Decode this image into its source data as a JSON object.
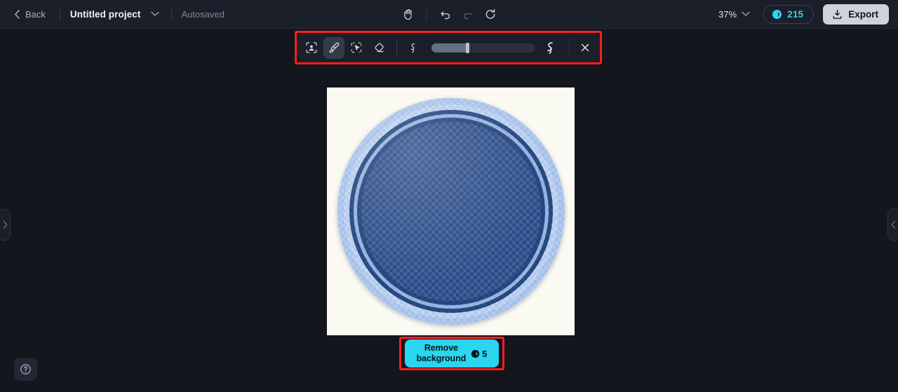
{
  "header": {
    "back_label": "Back",
    "project_title": "Untitled project",
    "project_menu_icon": "chevron-down-icon",
    "autosaved_label": "Autosaved",
    "tools": [
      {
        "name": "hand-tool",
        "icon": "hand-icon"
      },
      {
        "name": "undo-button",
        "icon": "undo-icon"
      },
      {
        "name": "redo-button",
        "icon": "redo-icon"
      },
      {
        "name": "reset-button",
        "icon": "refresh-icon"
      }
    ],
    "zoom_level": "37%",
    "zoom_menu_icon": "chevron-down-icon",
    "credits": {
      "icon": "coin-icon",
      "amount": "215"
    },
    "export_label": "Export",
    "export_icon": "download-icon"
  },
  "edit_toolbar": {
    "tools": [
      {
        "name": "select-subject-tool",
        "icon": "person-select-icon",
        "active": false
      },
      {
        "name": "brush-tool",
        "icon": "brush-icon",
        "active": true
      },
      {
        "name": "magic-select-tool",
        "icon": "magic-cursor-icon",
        "active": false
      },
      {
        "name": "eraser-tool",
        "icon": "eraser-icon",
        "active": false
      }
    ],
    "brush_size": {
      "min_icon": "small-brush-icon",
      "max_icon": "large-brush-icon",
      "value_percent": 33
    },
    "close_label": "",
    "close_icon": "close-icon",
    "highlight_color": "#fb1f1f"
  },
  "canvas": {
    "artboard_background": "#fbfaf2",
    "selection_mask_color": "#2d4c85",
    "subject": "circular-plate"
  },
  "actions": {
    "remove_background_label_line1": "Remove",
    "remove_background_label_line2": "background",
    "remove_background_cost": "5",
    "cost_icon": "coin-icon",
    "button_color": "#2ad6ef",
    "highlight_color": "#fb1f1f"
  },
  "panels": {
    "left_handle_icon": "chevron-right-icon",
    "right_handle_icon": "chevron-left-icon"
  },
  "help": {
    "icon": "question-circle-icon"
  }
}
